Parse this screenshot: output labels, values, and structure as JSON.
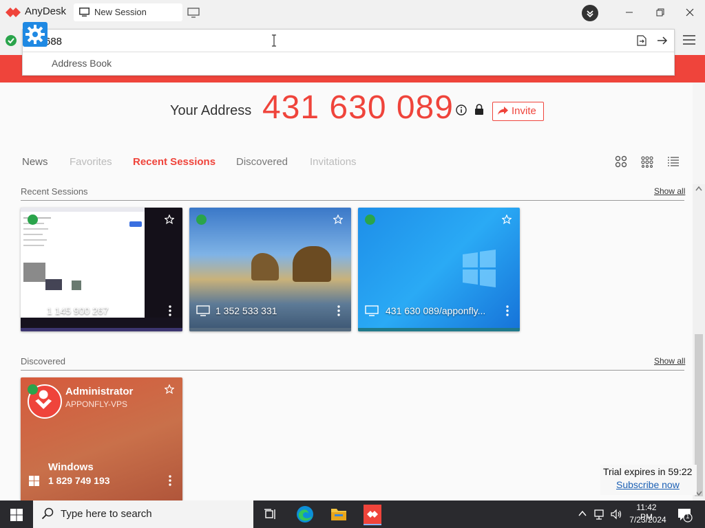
{
  "titlebar": {
    "app_name": "AnyDesk",
    "tab_label": "New Session"
  },
  "address_bar": {
    "input_value": "688",
    "suggestion": "Address Book"
  },
  "main": {
    "your_address_label": "Your Address",
    "address_number": "431 630 089",
    "invite_label": "Invite"
  },
  "tabs": [
    "News",
    "Favorites",
    "Recent Sessions",
    "Discovered",
    "Invitations"
  ],
  "recent_sessions": {
    "title": "Recent Sessions",
    "show_all": "Show all",
    "cards": [
      {
        "id": "1 145 900 267",
        "online": true
      },
      {
        "id": "1 352 533 331",
        "online": true
      },
      {
        "id": "431 630 089/apponfly...",
        "online": true
      }
    ]
  },
  "discovered": {
    "title": "Discovered",
    "show_all": "Show all",
    "card": {
      "user": "Administrator",
      "host": "APPONFLY-VPS",
      "os": "Windows",
      "id": "1 829 749 193"
    }
  },
  "trial": {
    "text": "Trial expires in 59:22",
    "link": "Subscribe now"
  },
  "taskbar": {
    "search_placeholder": "Type here to search",
    "time": "11:42 PM",
    "date": "7/23/2024",
    "notification_count": "1"
  },
  "colors": {
    "brand_red": "#ef443b",
    "online_green": "#2aa44b",
    "gear_blue": "#1f89e3"
  }
}
